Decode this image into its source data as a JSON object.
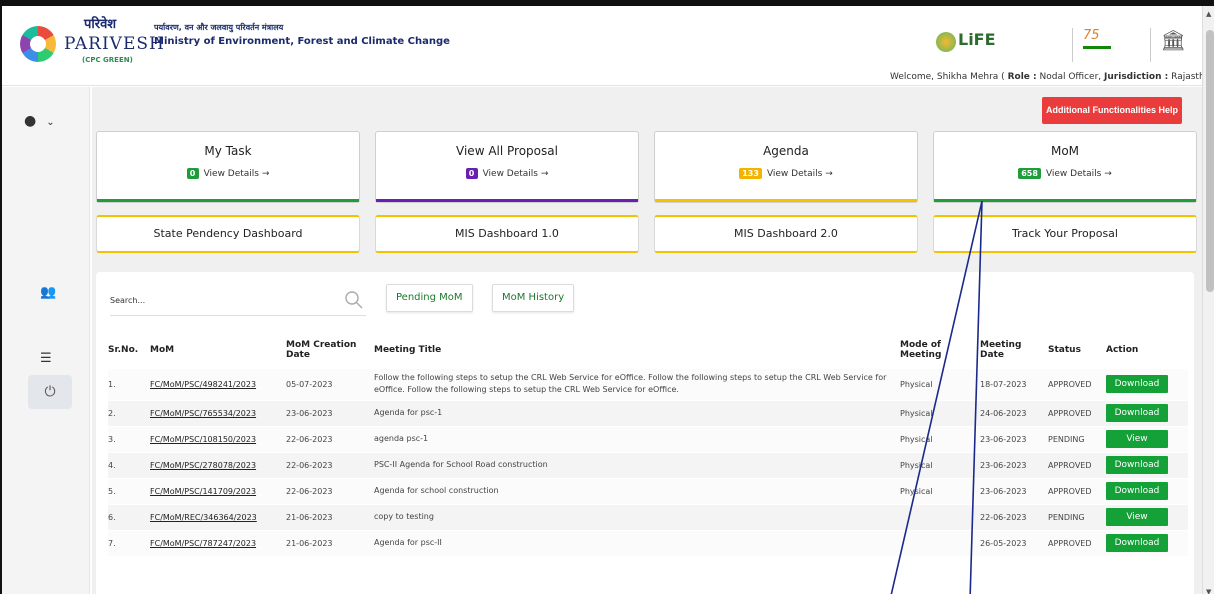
{
  "brand": {
    "hindi_name": "परिवेश",
    "name": "PARIVESH",
    "tagline": "(CPC GREEN)",
    "ministry_hindi": "पर्यावरण, वन और जलवायु परिवर्तन मंत्रालय",
    "ministry_en": "Ministry of Environment, Forest and Climate Change",
    "life_label": "LiFE"
  },
  "welcome": {
    "prefix": "Welcome, Shikha Mehra (",
    "role_label": "Role :",
    "role_value": "Nodal Officer,",
    "jurisdiction_label": "Jurisdiction :",
    "jurisdiction_value": "Rajasthan )"
  },
  "help_button": "Additional Functionalities Help",
  "cards": [
    {
      "title": "My Task",
      "count": "0",
      "details": "View Details →",
      "badge_color": "#1f9d3a",
      "bar_color": "#1f9d3a"
    },
    {
      "title": "View All Proposal",
      "count": "0",
      "details": "View Details →",
      "badge_color": "#6a1fb4",
      "bar_color": "#6a1fb4"
    },
    {
      "title": "Agenda",
      "count": "133",
      "details": "View Details →",
      "badge_color": "#f2b400",
      "bar_color": "#f2c400"
    },
    {
      "title": "MoM",
      "count": "658",
      "details": "View Details →",
      "badge_color": "#1f9d3a",
      "bar_color": "#1f9d3a"
    }
  ],
  "dashboards": [
    "State Pendency Dashboard",
    "MIS Dashboard 1.0",
    "MIS Dashboard 2.0",
    "Track Your Proposal"
  ],
  "search": {
    "placeholder": "Search..."
  },
  "tabs": [
    "Pending MoM",
    "MoM History"
  ],
  "table": {
    "headers": [
      "Sr.No.",
      "MoM",
      "MoM Creation Date",
      "Meeting Title",
      "Mode of Meeting",
      "Meeting Date",
      "Status",
      "Action"
    ],
    "rows": [
      {
        "sr": "1.",
        "mom": "FC/MoM/PSC/498241/2023",
        "created": "05-07-2023",
        "title": "Follow the following steps to setup the CRL Web Service for eOffice. Follow the following steps to setup the CRL Web Service for eOffice. Follow the following steps to setup the CRL Web Service for eOffice.",
        "mode": "Physical",
        "date": "18-07-2023",
        "status": "APPROVED",
        "action": "Download"
      },
      {
        "sr": "2.",
        "mom": "FC/MoM/PSC/765534/2023",
        "created": "23-06-2023",
        "title": "Agenda for psc-1",
        "mode": "Physical",
        "date": "24-06-2023",
        "status": "APPROVED",
        "action": "Download"
      },
      {
        "sr": "3.",
        "mom": "FC/MoM/PSC/108150/2023",
        "created": "22-06-2023",
        "title": "agenda psc-1",
        "mode": "Physical",
        "date": "23-06-2023",
        "status": "PENDING",
        "action": "View"
      },
      {
        "sr": "4.",
        "mom": "FC/MoM/PSC/278078/2023",
        "created": "22-06-2023",
        "title": "PSC-II Agenda for School Road construction",
        "mode": "Physical",
        "date": "23-06-2023",
        "status": "APPROVED",
        "action": "Download"
      },
      {
        "sr": "5.",
        "mom": "FC/MoM/PSC/141709/2023",
        "created": "22-06-2023",
        "title": "Agenda for school construction",
        "mode": "Physical",
        "date": "23-06-2023",
        "status": "APPROVED",
        "action": "Download"
      },
      {
        "sr": "6.",
        "mom": "FC/MoM/REC/346364/2023",
        "created": "21-06-2023",
        "title": "copy to testing",
        "mode": "",
        "date": "22-06-2023",
        "status": "PENDING",
        "action": "View"
      },
      {
        "sr": "7.",
        "mom": "FC/MoM/PSC/787247/2023",
        "created": "21-06-2023",
        "title": "Agenda for psc-II",
        "mode": "",
        "date": "26-05-2023",
        "status": "APPROVED",
        "action": "Download"
      }
    ]
  },
  "colors": {
    "help_button": "#ea3c3c",
    "action_button": "#14a138",
    "tab_text": "#1b7a2b",
    "brand_navy": "#1a2a6c"
  }
}
